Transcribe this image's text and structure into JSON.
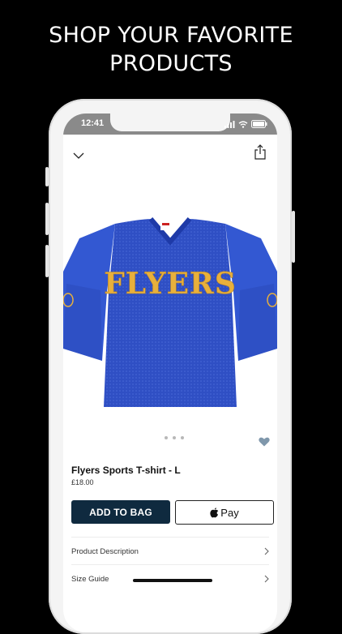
{
  "headline": {
    "line1": "SHOP YOUR FAVORITE",
    "line2": "PRODUCTS"
  },
  "status_bar": {
    "time": "12:41"
  },
  "icons": {
    "back": "chevron-down-icon",
    "share": "share-icon",
    "favorite": "heart-icon",
    "apple": "apple-logo-icon",
    "row_chevron": "chevron-right-icon"
  },
  "product": {
    "jersey_text": "FLYERS",
    "name": "Flyers Sports T-shirt - L",
    "price": "£18.00",
    "image_count": 3,
    "active_image": 1
  },
  "actions": {
    "add_to_bag": "ADD TO BAG",
    "apple_pay": "Pay"
  },
  "details_rows": [
    {
      "label": "Product Description"
    },
    {
      "label": "Size Guide"
    }
  ],
  "colors": {
    "accent": "#0f2a3f",
    "jersey_blue": "#2f4fc4",
    "lettering": "#e8b03c",
    "heart": "#7f97ab"
  }
}
